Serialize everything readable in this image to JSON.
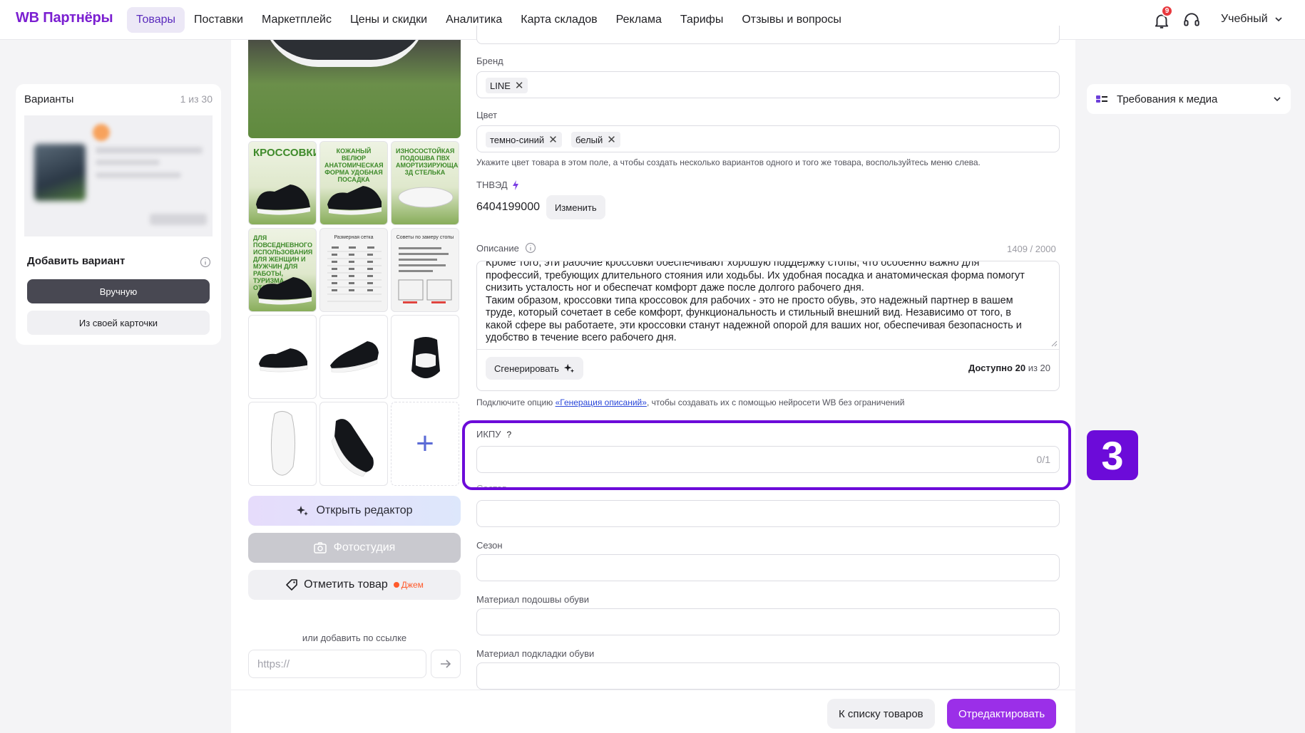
{
  "header": {
    "logo": "WB Партнёры",
    "nav": [
      "Товары",
      "Поставки",
      "Маркетплейс",
      "Цены и скидки",
      "Аналитика",
      "Карта складов",
      "Реклама",
      "Тарифы",
      "Отзывы и вопросы"
    ],
    "active_nav": "Товары",
    "notifications_count": "9",
    "account": "Учебный"
  },
  "variants": {
    "title": "Варианты",
    "count": "1 из 30",
    "add_title": "Добавить вариант",
    "manual_button": "Вручную",
    "own_card_button": "Из своей карточки"
  },
  "media": {
    "thumb_labels": {
      "sneakers": "КРОССОВКИ",
      "velcro": "КОЖАНЫЙ ВЕЛЮР АНАТОМИЧЕСКАЯ ФОРМА УДОБНАЯ ПОСАДКА",
      "sole": "ИЗНОСОСТОЙКАЯ ПОДОШВА ПВХ АМОРТИЗИРУЮЩАЯ 3Д СТЕЛЬКА",
      "everyday": "ДЛЯ ПОВСЕДНЕВНОГО ИСПОЛЬЗОВАНИЯ ДЛЯ ЖЕНЩИН И МУЖЧИН ДЛЯ РАБОТЫ, ТУРИЗМА, ОТДЫХА",
      "size_table": "Размерная сетка",
      "size_tips": "Советы по замеру стопы"
    },
    "open_editor": "Открыть редактор",
    "photo_studio": "Фотостудия",
    "mark_product": "Отметить товар",
    "jam": "Джем",
    "or_link": "или добавить по ссылке",
    "url_placeholder": "https://"
  },
  "form": {
    "brand_label": "Бренд",
    "brand_tags": [
      "LINE"
    ],
    "color_label": "Цвет",
    "color_tags": [
      "темно-синий",
      "белый"
    ],
    "color_hint": "Укажите цвет товара в этом поле, а чтобы создать несколько вариантов одного и того же товара, воспользуйтесь меню слева.",
    "tnved_label": "ТНВЭД",
    "tnved_value": "6404199000",
    "change_button": "Изменить",
    "description_label": "Описание",
    "description_counter": "1409 / 2000",
    "description_text": "Кроме того, эти рабочие кроссовки обеспечивают хорошую поддержку стопы, что особенно важно для профессий, требующих длительного стояния или ходьбы. Их удобная посадка и анатомическая форма помогут снизить усталость ног и обеспечат комфорт даже после долгого рабочего дня.\nТаким образом, кроссовки типа кроссовок для рабочих - это не просто обувь, это надежный партнер в вашем труде, который сочетает в себе комфорт, функциональность и стильный внешний вид. Независимо от того, в какой сфере вы работаете, эти кроссовки станут надежной опорой для ваших ног, обеспечивая безопасность и удобство в течение всего рабочего дня.",
    "generate_button": "Сгенерировать",
    "available_label": "Доступно",
    "available_count": "20",
    "available_of": "из 20",
    "generation_hint_prefix": "Подключите опцию ",
    "generation_hint_link": "«Генерация описаний»",
    "generation_hint_suffix": ", чтобы создавать их с помощью нейросети WB без ограничений",
    "ikpu_label": "ИКПУ",
    "ikpu_help": "?",
    "ikpu_counter": "0/1",
    "next_label_partial": "Состав",
    "season_label": "Сезон",
    "sole_material_label": "Материал подошвы обуви",
    "lining_material_label": "Материал подкладки обуви"
  },
  "annotation": {
    "step_number": "3",
    "color": "#6c0bd9"
  },
  "requirements": {
    "label": "Требования к медиа"
  },
  "footer": {
    "back_button": "К списку товаров",
    "edit_button": "Отредактировать"
  },
  "colors": {
    "brand_purple": "#7b1fd1",
    "primary_button": "#9b2fe8",
    "notification_red": "#e8383d"
  }
}
